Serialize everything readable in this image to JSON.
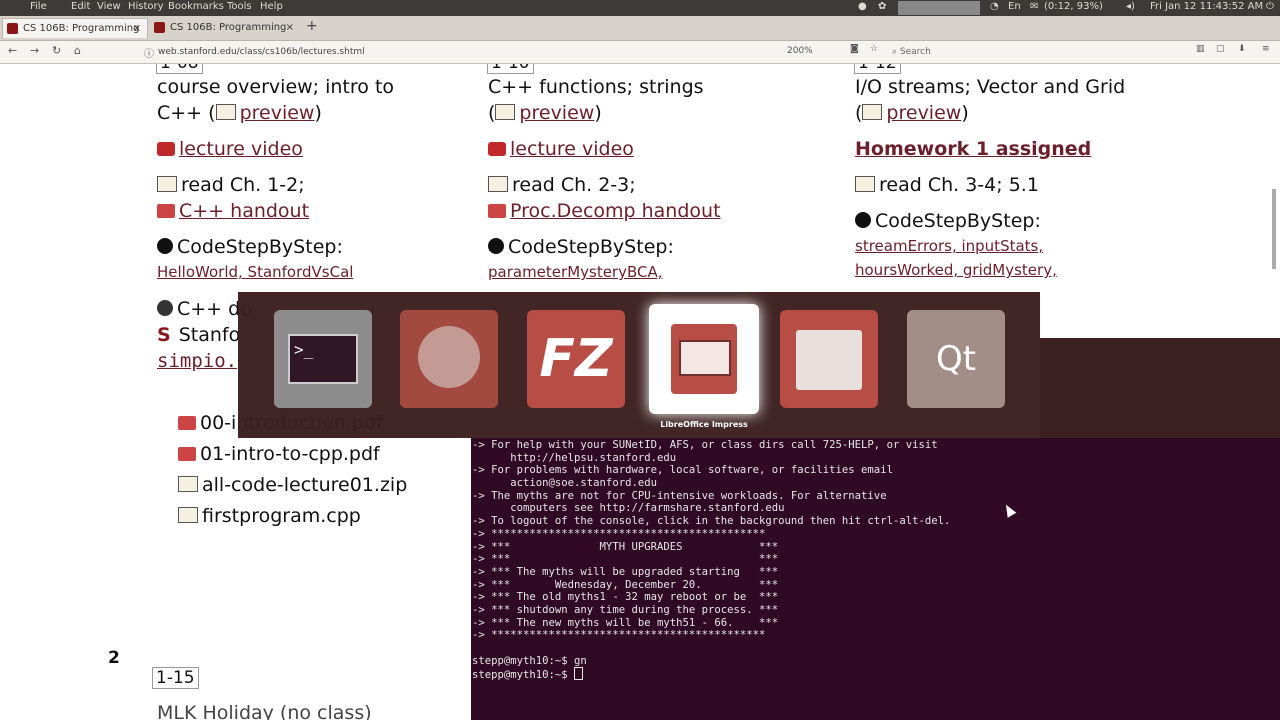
{
  "topbar": {
    "menus": [
      "File",
      "Edit",
      "View",
      "History",
      "Bookmarks",
      "Tools",
      "Help"
    ],
    "battery": "(0:12, 93%)",
    "clock": "Fri Jan 12   11:43:52 AM"
  },
  "tabs": [
    {
      "label": "CS 106B: Programming"
    },
    {
      "label": "CS 106B: Programming"
    }
  ],
  "navbar": {
    "url": "web.stanford.edu/class/cs106b/lectures.shtml",
    "zoom": "200%",
    "search_placeholder": "Search"
  },
  "page": {
    "col1": {
      "badge": "1-08",
      "title_a": "course overview; intro to",
      "title_b": "C++ (",
      "preview": "preview",
      "title_end": ")",
      "video": "lecture video",
      "read": "read Ch. 1-2;",
      "handout": "C++ handout",
      "codestep": "CodeStepByStep:",
      "problems": "HelloWorld, StanfordVsCal",
      "cpp_docs": "C++ do",
      "stanford": "Stanfo",
      "simpio": "simpio.",
      "files": [
        "00-introduction.pdf",
        "01-intro-to-cpp.pdf",
        "all-code-lecture01.zip",
        "firstprogram.cpp"
      ]
    },
    "col2": {
      "badge": "1-10",
      "title_a": "C++ functions; strings",
      "preview": "preview",
      "video": "lecture video",
      "read": "read Ch. 2-3;",
      "handout": "Proc.Decomp handout",
      "codestep": "CodeStepByStep:",
      "problems": "parameterMysteryBCA,"
    },
    "col3": {
      "badge": "1-12",
      "title_a": "I/O streams; Vector and Grid",
      "preview": "preview",
      "homework": "Homework 1 assigned",
      "read": "read Ch. 3-4; 5.1",
      "codestep": "CodeStepByStep:",
      "problems_a": "streamErrors, inputStats,",
      "problems_b": "hoursWorked, gridMystery,"
    },
    "week": "2",
    "next_badge": "1-15",
    "next_title": "MLK Holiday (no class)"
  },
  "switcher": {
    "apps": [
      "terminal-icon",
      "firefox-icon",
      "filezilla-icon",
      "libreoffice-impress-icon",
      "file-manager-icon",
      "qt-creator-icon"
    ],
    "selected_label": "LibreOffice Impress"
  },
  "terminal": {
    "lines": [
      "-> For help with your SUNetID, AFS, or class dirs call 725-HELP, or visit",
      "      http://helpsu.stanford.edu",
      "-> For problems with hardware, local software, or facilities email",
      "      action@soe.stanford.edu",
      "-> The myths are not for CPU-intensive workloads. For alternative",
      "      computers see http://farmshare.stanford.edu",
      "-> To logout of the console, click in the background then hit ctrl-alt-del.",
      "-> *******************************************",
      "-> ***              MYTH UPGRADES            ***",
      "-> ***                                       ***",
      "-> *** The myths will be upgraded starting   ***",
      "-> ***       Wednesday, December 20.         ***",
      "-> *** The old myths1 - 32 may reboot or be  ***",
      "-> *** shutdown any time during the process. ***",
      "-> *** The new myths will be myth51 - 66.    ***",
      "-> *******************************************",
      "",
      "stepp@myth10:~$ gn",
      "stepp@myth10:~$ "
    ]
  }
}
